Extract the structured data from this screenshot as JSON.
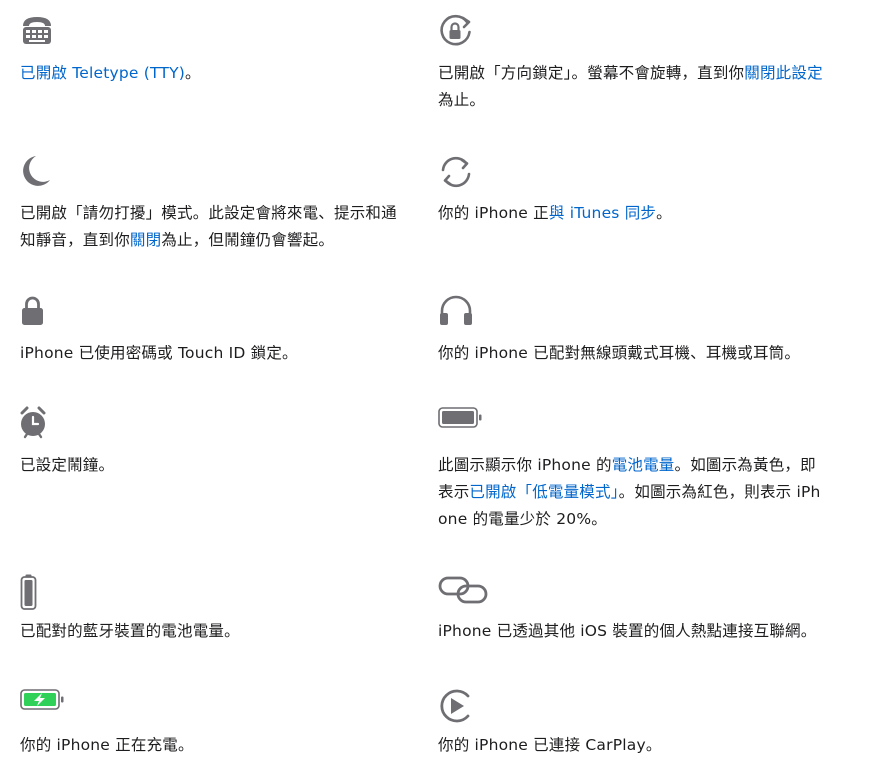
{
  "colors": {
    "icon": "#6e6e73",
    "link": "#0066cc",
    "text": "#1d1d1f",
    "battery_charging": "#30d158"
  },
  "items": [
    {
      "icon": "tty-icon",
      "parts": [
        {
          "text": "已開啟 Teletype (TTY)",
          "link": true
        },
        {
          "text": "。"
        }
      ]
    },
    {
      "icon": "rotation-lock-icon",
      "parts": [
        {
          "text": "已開啟「方向鎖定」。螢幕不會旋轉，直到你"
        },
        {
          "text": "關閉此設定",
          "link": true
        },
        {
          "text": "為止。"
        }
      ]
    },
    {
      "icon": "moon-icon",
      "parts": [
        {
          "text": "已開啟「請勿打擾」模式。此設定會將來電、提示和通知靜音，直到你"
        },
        {
          "text": "關閉",
          "link": true
        },
        {
          "text": "為止，但鬧鐘仍會響起。"
        }
      ]
    },
    {
      "icon": "sync-icon",
      "parts": [
        {
          "text": "你的 iPhone 正"
        },
        {
          "text": "與 iTunes 同步",
          "link": true
        },
        {
          "text": "。"
        }
      ]
    },
    {
      "icon": "lock-icon",
      "parts": [
        {
          "text": "iPhone 已使用密碼或 Touch ID 鎖定。"
        }
      ]
    },
    {
      "icon": "headphones-icon",
      "parts": [
        {
          "text": "你的 iPhone 已配對無線頭戴式耳機、耳機或耳筒。"
        }
      ]
    },
    {
      "icon": "alarm-clock-icon",
      "parts": [
        {
          "text": "已設定鬧鐘。"
        }
      ]
    },
    {
      "icon": "battery-icon",
      "parts": [
        {
          "text": "此圖示顯示你 iPhone 的"
        },
        {
          "text": "電池電量",
          "link": true
        },
        {
          "text": "。如圖示為黃色，即表示"
        },
        {
          "text": "已開啟「低電量模式」",
          "link": true
        },
        {
          "text": "。如圖示為紅色，則表示 iPhone 的電量少於 20%。"
        }
      ]
    },
    {
      "icon": "bluetooth-battery-icon",
      "parts": [
        {
          "text": "已配對的藍牙裝置的電池電量。"
        }
      ]
    },
    {
      "icon": "personal-hotspot-icon",
      "parts": [
        {
          "text": "iPhone 已透過其他 iOS 裝置的個人熱點連接互聯網。"
        }
      ]
    },
    {
      "icon": "charging-battery-icon",
      "parts": [
        {
          "text": "你的 iPhone 正在充電。"
        }
      ]
    },
    {
      "icon": "carplay-icon",
      "parts": [
        {
          "text": "你的 iPhone 已連接 CarPlay。"
        }
      ]
    }
  ]
}
